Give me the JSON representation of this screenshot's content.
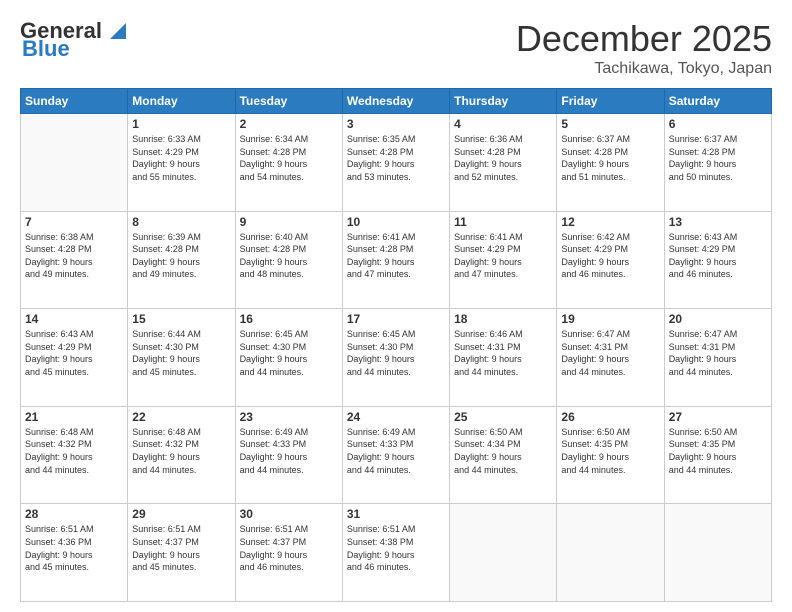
{
  "logo": {
    "line1": "General",
    "line2": "Blue"
  },
  "header": {
    "month": "December 2025",
    "location": "Tachikawa, Tokyo, Japan"
  },
  "weekdays": [
    "Sunday",
    "Monday",
    "Tuesday",
    "Wednesday",
    "Thursday",
    "Friday",
    "Saturday"
  ],
  "weeks": [
    [
      {
        "day": "",
        "info": ""
      },
      {
        "day": "1",
        "info": "Sunrise: 6:33 AM\nSunset: 4:29 PM\nDaylight: 9 hours\nand 55 minutes."
      },
      {
        "day": "2",
        "info": "Sunrise: 6:34 AM\nSunset: 4:28 PM\nDaylight: 9 hours\nand 54 minutes."
      },
      {
        "day": "3",
        "info": "Sunrise: 6:35 AM\nSunset: 4:28 PM\nDaylight: 9 hours\nand 53 minutes."
      },
      {
        "day": "4",
        "info": "Sunrise: 6:36 AM\nSunset: 4:28 PM\nDaylight: 9 hours\nand 52 minutes."
      },
      {
        "day": "5",
        "info": "Sunrise: 6:37 AM\nSunset: 4:28 PM\nDaylight: 9 hours\nand 51 minutes."
      },
      {
        "day": "6",
        "info": "Sunrise: 6:37 AM\nSunset: 4:28 PM\nDaylight: 9 hours\nand 50 minutes."
      }
    ],
    [
      {
        "day": "7",
        "info": "Sunrise: 6:38 AM\nSunset: 4:28 PM\nDaylight: 9 hours\nand 49 minutes."
      },
      {
        "day": "8",
        "info": "Sunrise: 6:39 AM\nSunset: 4:28 PM\nDaylight: 9 hours\nand 49 minutes."
      },
      {
        "day": "9",
        "info": "Sunrise: 6:40 AM\nSunset: 4:28 PM\nDaylight: 9 hours\nand 48 minutes."
      },
      {
        "day": "10",
        "info": "Sunrise: 6:41 AM\nSunset: 4:28 PM\nDaylight: 9 hours\nand 47 minutes."
      },
      {
        "day": "11",
        "info": "Sunrise: 6:41 AM\nSunset: 4:29 PM\nDaylight: 9 hours\nand 47 minutes."
      },
      {
        "day": "12",
        "info": "Sunrise: 6:42 AM\nSunset: 4:29 PM\nDaylight: 9 hours\nand 46 minutes."
      },
      {
        "day": "13",
        "info": "Sunrise: 6:43 AM\nSunset: 4:29 PM\nDaylight: 9 hours\nand 46 minutes."
      }
    ],
    [
      {
        "day": "14",
        "info": "Sunrise: 6:43 AM\nSunset: 4:29 PM\nDaylight: 9 hours\nand 45 minutes."
      },
      {
        "day": "15",
        "info": "Sunrise: 6:44 AM\nSunset: 4:30 PM\nDaylight: 9 hours\nand 45 minutes."
      },
      {
        "day": "16",
        "info": "Sunrise: 6:45 AM\nSunset: 4:30 PM\nDaylight: 9 hours\nand 44 minutes."
      },
      {
        "day": "17",
        "info": "Sunrise: 6:45 AM\nSunset: 4:30 PM\nDaylight: 9 hours\nand 44 minutes."
      },
      {
        "day": "18",
        "info": "Sunrise: 6:46 AM\nSunset: 4:31 PM\nDaylight: 9 hours\nand 44 minutes."
      },
      {
        "day": "19",
        "info": "Sunrise: 6:47 AM\nSunset: 4:31 PM\nDaylight: 9 hours\nand 44 minutes."
      },
      {
        "day": "20",
        "info": "Sunrise: 6:47 AM\nSunset: 4:31 PM\nDaylight: 9 hours\nand 44 minutes."
      }
    ],
    [
      {
        "day": "21",
        "info": "Sunrise: 6:48 AM\nSunset: 4:32 PM\nDaylight: 9 hours\nand 44 minutes."
      },
      {
        "day": "22",
        "info": "Sunrise: 6:48 AM\nSunset: 4:32 PM\nDaylight: 9 hours\nand 44 minutes."
      },
      {
        "day": "23",
        "info": "Sunrise: 6:49 AM\nSunset: 4:33 PM\nDaylight: 9 hours\nand 44 minutes."
      },
      {
        "day": "24",
        "info": "Sunrise: 6:49 AM\nSunset: 4:33 PM\nDaylight: 9 hours\nand 44 minutes."
      },
      {
        "day": "25",
        "info": "Sunrise: 6:50 AM\nSunset: 4:34 PM\nDaylight: 9 hours\nand 44 minutes."
      },
      {
        "day": "26",
        "info": "Sunrise: 6:50 AM\nSunset: 4:35 PM\nDaylight: 9 hours\nand 44 minutes."
      },
      {
        "day": "27",
        "info": "Sunrise: 6:50 AM\nSunset: 4:35 PM\nDaylight: 9 hours\nand 44 minutes."
      }
    ],
    [
      {
        "day": "28",
        "info": "Sunrise: 6:51 AM\nSunset: 4:36 PM\nDaylight: 9 hours\nand 45 minutes."
      },
      {
        "day": "29",
        "info": "Sunrise: 6:51 AM\nSunset: 4:37 PM\nDaylight: 9 hours\nand 45 minutes."
      },
      {
        "day": "30",
        "info": "Sunrise: 6:51 AM\nSunset: 4:37 PM\nDaylight: 9 hours\nand 46 minutes."
      },
      {
        "day": "31",
        "info": "Sunrise: 6:51 AM\nSunset: 4:38 PM\nDaylight: 9 hours\nand 46 minutes."
      },
      {
        "day": "",
        "info": ""
      },
      {
        "day": "",
        "info": ""
      },
      {
        "day": "",
        "info": ""
      }
    ]
  ]
}
